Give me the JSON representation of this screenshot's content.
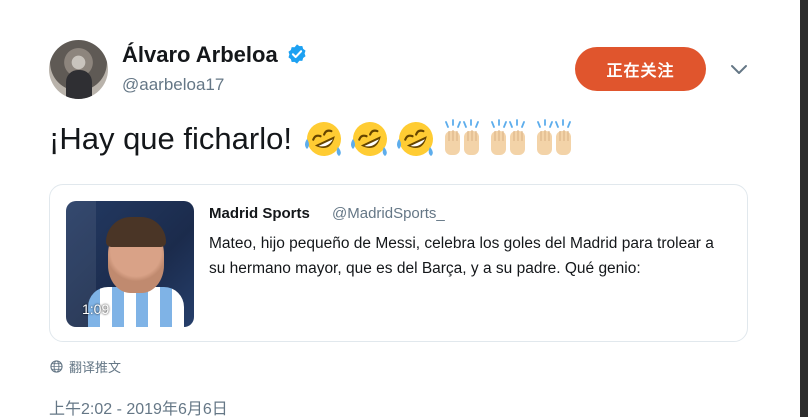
{
  "author": {
    "name": "Álvaro Arbeloa",
    "handle": "@aarbeloa17",
    "verified_icon": "verified-badge-icon"
  },
  "follow_button": {
    "label": "正在关注"
  },
  "menu_icon": "chevron-down-icon",
  "tweet": {
    "text": "¡Hay que ficharlo!",
    "emojis": [
      "rolling-on-floor-laughing-emoji",
      "rolling-on-floor-laughing-emoji",
      "rolling-on-floor-laughing-emoji",
      "raising-hands-emoji",
      "raising-hands-emoji",
      "raising-hands-emoji"
    ]
  },
  "quote": {
    "name": "Madrid Sports",
    "handle": "@MadridSports_",
    "text": "Mateo, hijo pequeño de Messi, celebra los goles del Madrid para trolear a su hermano mayor, que es del Barça, y a su padre. Qué genio:",
    "video_duration": "1:09"
  },
  "translate": {
    "label": "翻译推文",
    "icon": "globe-icon"
  },
  "timestamp": "上午2:02 - 2019年6月6日",
  "colors": {
    "follow": "#e0552d",
    "verified": "#1da1f2",
    "secondary_text": "#657786",
    "border": "#e1e8ed"
  }
}
